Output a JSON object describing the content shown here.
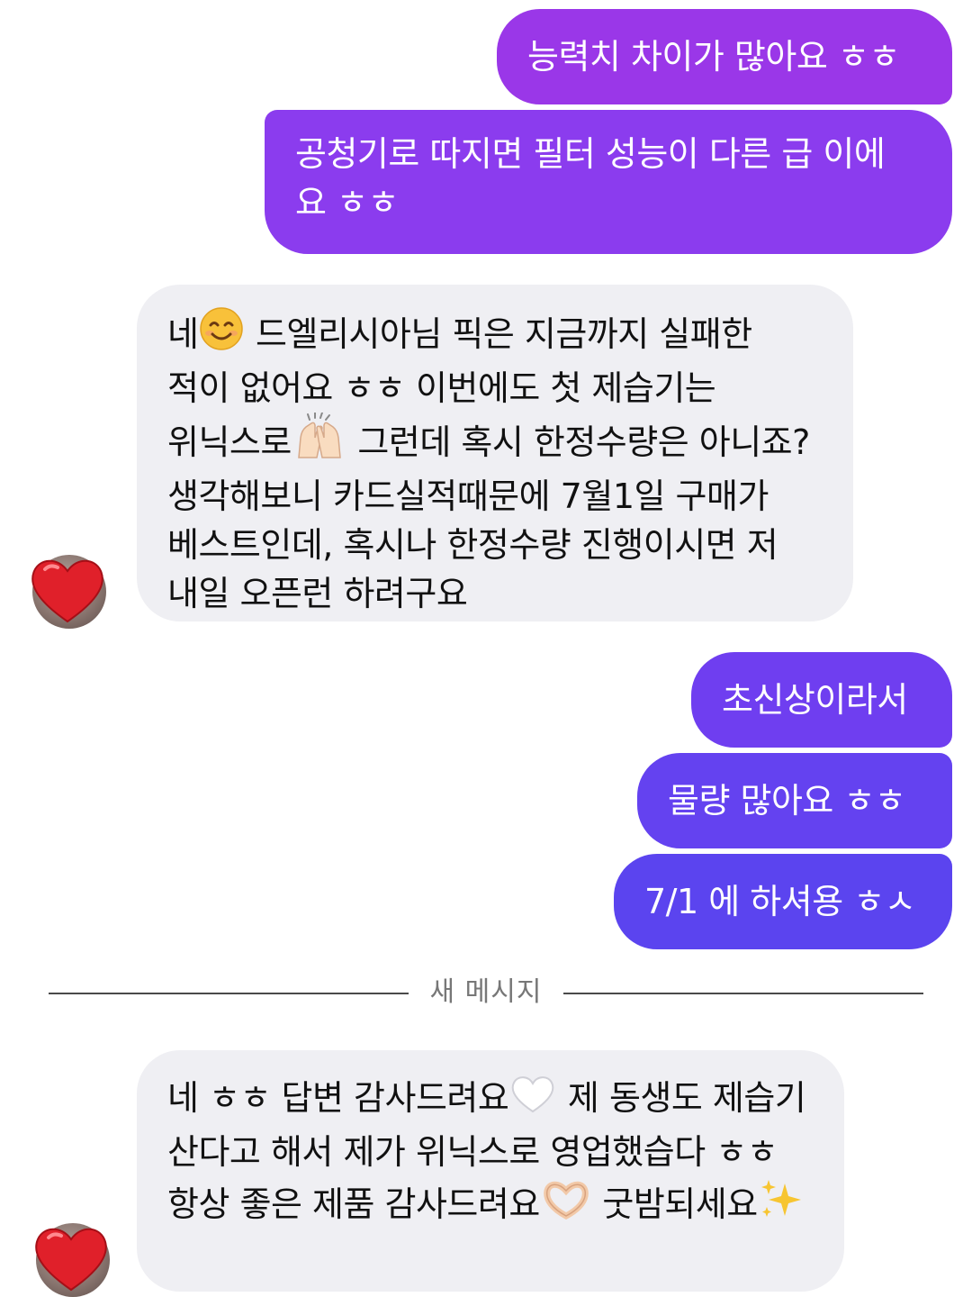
{
  "messages": {
    "out_1": {
      "text": "능력치 차이가 많아요 ㅎㅎ"
    },
    "out_2": {
      "line1": "공청기로 따지면 필터 성능이 다른 급 이에",
      "line2": "요 ㅎㅎ"
    },
    "in_1": {
      "part1": "네",
      "part2": " 드엘리시아님 픽은 지금까지 실패한 적이 없어요 ㅎㅎ 이번에도 첫 제습기는 위닉스로",
      "part3": " 그런데 혹시 한정수량은 아니죠? 생각해보니 카드실적때문에 7월1일 구매가 베스트인데, 혹시나 한정수량 진행이시면 저 내일 오픈런 하려구요"
    },
    "out_3": {
      "text": "초신상이라서"
    },
    "out_4": {
      "text": "물량 많아요 ㅎㅎ"
    },
    "out_5": {
      "text": "7/1 에 하셔용 ㅎㅅ"
    },
    "in_2": {
      "part1": "네 ㅎㅎ 답변 감사드려요",
      "part2": " 제 동생도 제습기 산다고 해서 제가 위닉스로 영업했습다 ㅎㅎ 항상 좋은 제품 감사드려요",
      "part3": " 굿밤되세요"
    }
  },
  "divider": {
    "label": "새 메시지"
  },
  "icons": {
    "smile": "smiling-face-emoji",
    "raised_hands": "raised-hands-emoji",
    "white_heart": "white-heart-emoji",
    "heart_hands": "heart-hands-emoji",
    "sparkles": "sparkles-emoji",
    "reaction": "red-heart-reaction"
  },
  "colors": {
    "outgoing_top": "#9a3ee6",
    "outgoing_mid": "#7f3ef0",
    "outgoing_bottom": "#5b4aef",
    "incoming": "#efeff3",
    "heart": "#e0202a"
  }
}
